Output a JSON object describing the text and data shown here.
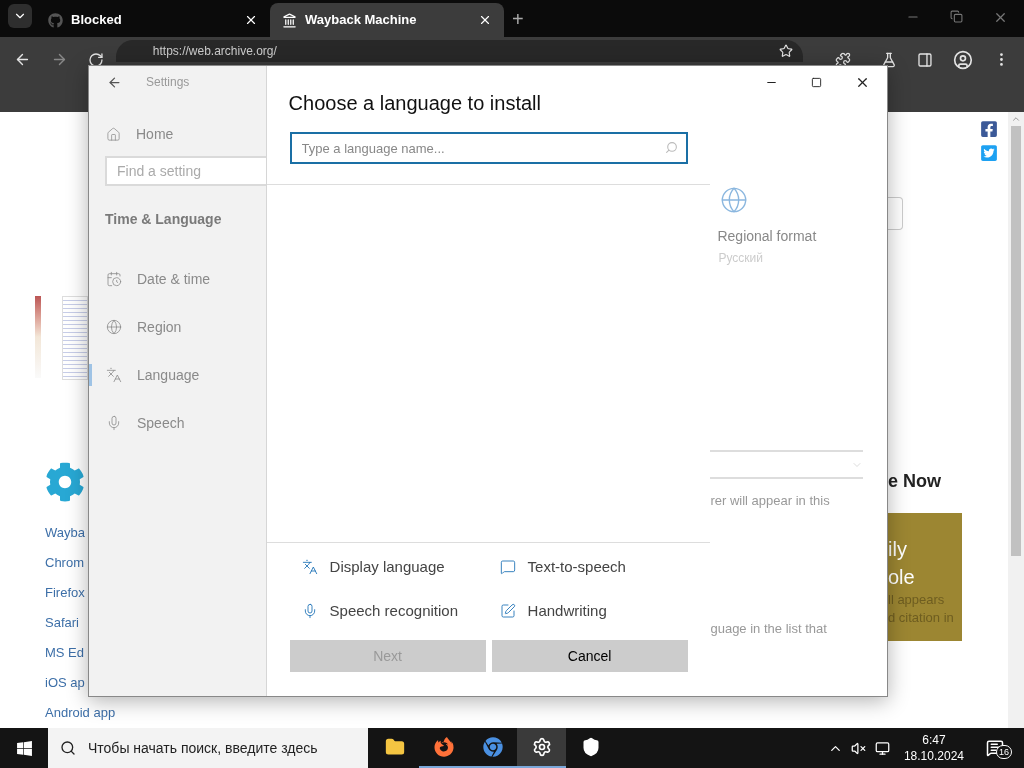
{
  "browser": {
    "tabs": [
      {
        "title": "Blocked",
        "kind": "github",
        "selected": false
      },
      {
        "title": "Wayback Machine",
        "kind": "archive",
        "selected": true
      }
    ],
    "new_tab": "+",
    "address": "https://web.archive.org/"
  },
  "web_page": {
    "links": [
      "Wayba",
      "Chrom",
      "Firefox",
      "Safari",
      "MS Ed",
      "iOS ap",
      "Android app"
    ],
    "heading": "e Now",
    "banner": {
      "lines": [
        "ily",
        "ole"
      ],
      "sub": [
        "ll appears",
        "d citation in"
      ]
    }
  },
  "settings": {
    "title": "Settings",
    "home": "Home",
    "search_placeholder": "Find a setting",
    "section": "Time & Language",
    "nav": [
      {
        "label": "Date & time",
        "kind": "clock",
        "selected": false
      },
      {
        "label": "Region",
        "kind": "globe",
        "selected": false
      },
      {
        "label": "Language",
        "kind": "language",
        "selected": true
      },
      {
        "label": "Speech",
        "kind": "mic",
        "selected": false
      }
    ],
    "regional_format": {
      "label": "Regional format",
      "value": "Русский"
    },
    "texts": [
      "rer will appear in this",
      "guage in the list that"
    ]
  },
  "dialog": {
    "title": "Choose a language to install",
    "search_placeholder": "Type a language name...",
    "features": [
      {
        "label": "Display language",
        "kind": "display"
      },
      {
        "label": "Text-to-speech",
        "kind": "tts"
      },
      {
        "label": "Speech recognition",
        "kind": "speech"
      },
      {
        "label": "Handwriting",
        "kind": "handwriting"
      }
    ],
    "buttons": [
      {
        "label": "Next",
        "disabled": true
      },
      {
        "label": "Cancel",
        "disabled": false
      }
    ]
  },
  "taskbar": {
    "search_placeholder": "Чтобы начать поиск, введите здесь",
    "apps": [
      {
        "kind": "explorer",
        "running": false,
        "selected": false
      },
      {
        "kind": "firefox",
        "running": true,
        "selected": false
      },
      {
        "kind": "chrome",
        "running": true,
        "selected": false
      },
      {
        "kind": "settings",
        "running": true,
        "selected": true
      },
      {
        "kind": "shield",
        "running": false,
        "selected": false
      }
    ],
    "time": "6:47",
    "date": "18.10.2024",
    "notifications": "16"
  }
}
